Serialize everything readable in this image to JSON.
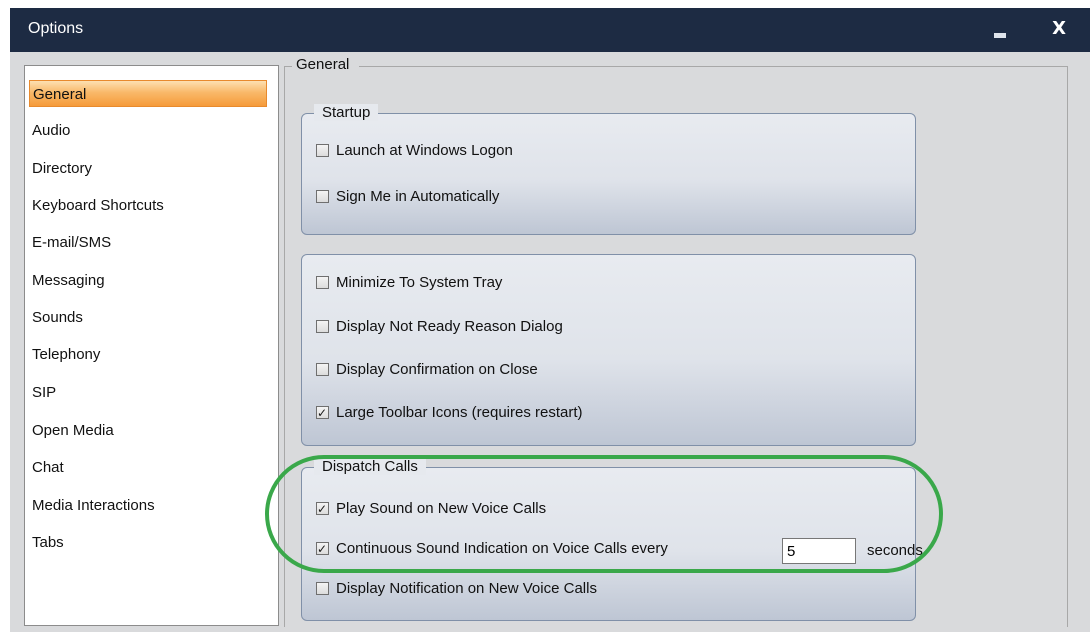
{
  "window": {
    "title": "Options",
    "minimize_icon": "minimize-icon",
    "close_label": "X"
  },
  "nav": {
    "items": [
      {
        "label": "General",
        "selected": true
      },
      {
        "label": "Audio"
      },
      {
        "label": "Directory"
      },
      {
        "label": "Keyboard Shortcuts"
      },
      {
        "label": "E-mail/SMS"
      },
      {
        "label": "Messaging"
      },
      {
        "label": "Sounds"
      },
      {
        "label": "Telephony"
      },
      {
        "label": "SIP"
      },
      {
        "label": "Open Media"
      },
      {
        "label": "Chat"
      },
      {
        "label": "Media Interactions"
      },
      {
        "label": "Tabs"
      }
    ]
  },
  "general": {
    "legend": "General",
    "startup": {
      "legend": "Startup",
      "options": [
        {
          "label": "Launch at Windows Logon",
          "checked": false
        },
        {
          "label": "Sign Me in Automatically",
          "checked": false
        }
      ]
    },
    "display": {
      "options": [
        {
          "label": "Minimize To System Tray",
          "checked": false
        },
        {
          "label": "Display Not Ready Reason Dialog",
          "checked": false
        },
        {
          "label": "Display Confirmation on Close",
          "checked": false
        },
        {
          "label": "Large Toolbar Icons (requires restart)",
          "checked": true
        }
      ]
    },
    "dispatch": {
      "legend": "Dispatch Calls",
      "options": [
        {
          "label": "Play Sound on New Voice Calls",
          "checked": true
        },
        {
          "label": "Continuous Sound Indication on Voice Calls every",
          "checked": true
        },
        {
          "label": "Display Notification on New Voice Calls",
          "checked": false
        }
      ],
      "interval_value": "5",
      "interval_unit": "seconds"
    }
  },
  "annotation": {
    "color": "#3aa84a"
  }
}
